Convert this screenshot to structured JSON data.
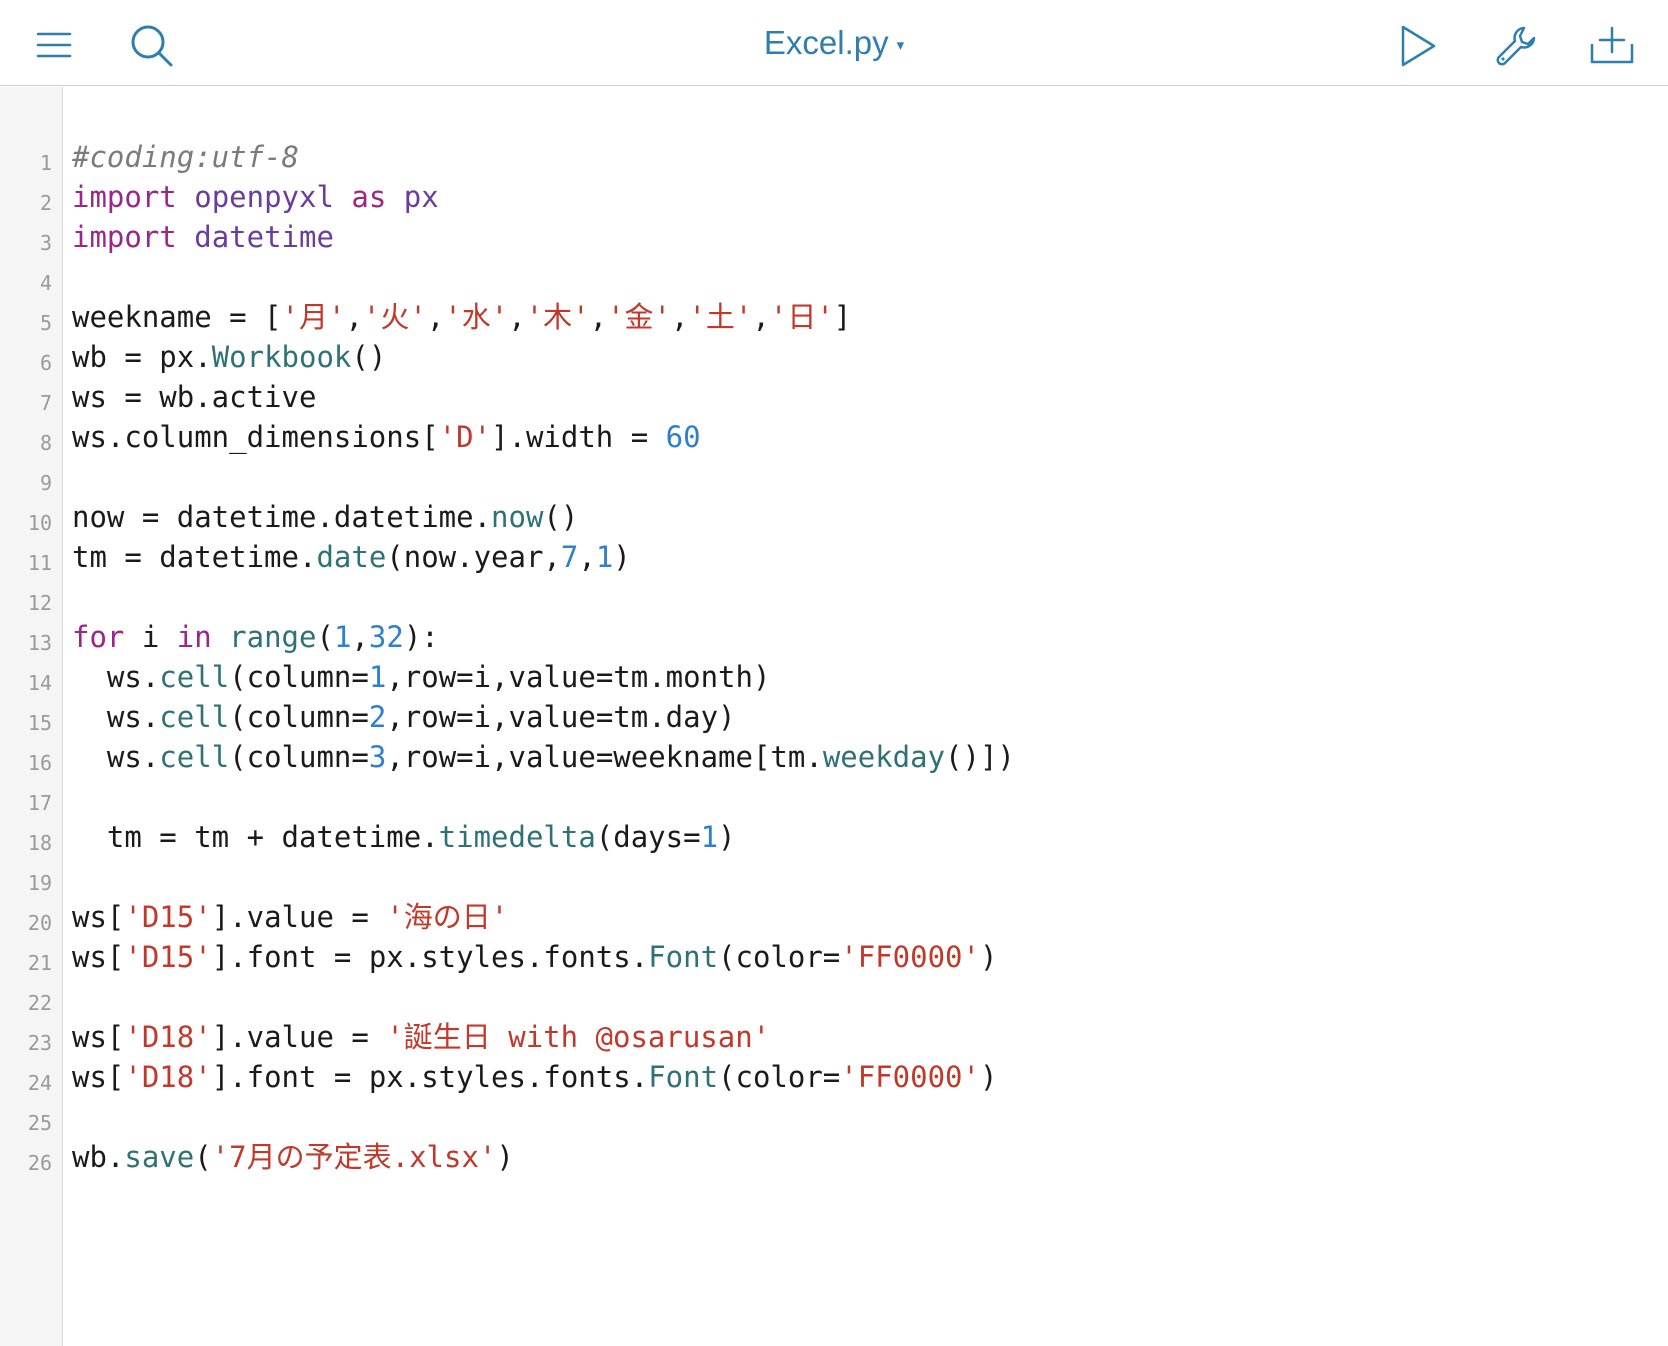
{
  "toolbar": {
    "file_name": "Excel.py",
    "dropdown_caret": "▾",
    "icons": {
      "menu": "hamburger-menu-icon",
      "search": "magnifier-search-icon",
      "run": "play-triangle-icon",
      "settings": "wrench-icon",
      "new": "tray-plus-icon"
    },
    "accent_color": "#2f7fae"
  },
  "editor": {
    "syntax_colors": {
      "comment": "#7b7b7b",
      "keyword": "#9a2788",
      "module": "#6a3c9c",
      "string": "#c0392b",
      "number": "#2f7fcf",
      "function": "#2e7277",
      "text": "#1a1a1a"
    },
    "lines": [
      {
        "n": "1",
        "tokens": [
          {
            "t": "#coding:utf-8",
            "c": "comment"
          }
        ]
      },
      {
        "n": "2",
        "tokens": [
          {
            "t": "import",
            "c": "kw"
          },
          {
            "t": " ",
            "c": "txt"
          },
          {
            "t": "openpyxl",
            "c": "mod"
          },
          {
            "t": " ",
            "c": "txt"
          },
          {
            "t": "as",
            "c": "kw"
          },
          {
            "t": " ",
            "c": "txt"
          },
          {
            "t": "px",
            "c": "mod"
          }
        ]
      },
      {
        "n": "3",
        "tokens": [
          {
            "t": "import",
            "c": "kw"
          },
          {
            "t": " ",
            "c": "txt"
          },
          {
            "t": "datetime",
            "c": "mod"
          }
        ]
      },
      {
        "n": "4",
        "tokens": []
      },
      {
        "n": "5",
        "tokens": [
          {
            "t": "weekname = [",
            "c": "txt"
          },
          {
            "t": "'月'",
            "c": "str"
          },
          {
            "t": ",",
            "c": "txt"
          },
          {
            "t": "'火'",
            "c": "str"
          },
          {
            "t": ",",
            "c": "txt"
          },
          {
            "t": "'水'",
            "c": "str"
          },
          {
            "t": ",",
            "c": "txt"
          },
          {
            "t": "'木'",
            "c": "str"
          },
          {
            "t": ",",
            "c": "txt"
          },
          {
            "t": "'金'",
            "c": "str"
          },
          {
            "t": ",",
            "c": "txt"
          },
          {
            "t": "'土'",
            "c": "str"
          },
          {
            "t": ",",
            "c": "txt"
          },
          {
            "t": "'日'",
            "c": "str"
          },
          {
            "t": "]",
            "c": "txt"
          }
        ]
      },
      {
        "n": "6",
        "tokens": [
          {
            "t": "wb = px.",
            "c": "txt"
          },
          {
            "t": "Workbook",
            "c": "fn"
          },
          {
            "t": "()",
            "c": "txt"
          }
        ]
      },
      {
        "n": "7",
        "tokens": [
          {
            "t": "ws = wb.active",
            "c": "txt"
          }
        ]
      },
      {
        "n": "8",
        "tokens": [
          {
            "t": "ws.column_dimensions[",
            "c": "txt"
          },
          {
            "t": "'D'",
            "c": "str"
          },
          {
            "t": "].width = ",
            "c": "txt"
          },
          {
            "t": "60",
            "c": "num"
          }
        ]
      },
      {
        "n": "9",
        "tokens": []
      },
      {
        "n": "10",
        "tokens": [
          {
            "t": "now = datetime.datetime.",
            "c": "txt"
          },
          {
            "t": "now",
            "c": "fn"
          },
          {
            "t": "()",
            "c": "txt"
          }
        ]
      },
      {
        "n": "11",
        "tokens": [
          {
            "t": "tm = datetime.",
            "c": "txt"
          },
          {
            "t": "date",
            "c": "fn"
          },
          {
            "t": "(now.year,",
            "c": "txt"
          },
          {
            "t": "7",
            "c": "num"
          },
          {
            "t": ",",
            "c": "txt"
          },
          {
            "t": "1",
            "c": "num"
          },
          {
            "t": ")",
            "c": "txt"
          }
        ]
      },
      {
        "n": "12",
        "tokens": []
      },
      {
        "n": "13",
        "tokens": [
          {
            "t": "for",
            "c": "kw"
          },
          {
            "t": " i ",
            "c": "txt"
          },
          {
            "t": "in",
            "c": "kw"
          },
          {
            "t": " ",
            "c": "txt"
          },
          {
            "t": "range",
            "c": "fn"
          },
          {
            "t": "(",
            "c": "txt"
          },
          {
            "t": "1",
            "c": "num"
          },
          {
            "t": ",",
            "c": "txt"
          },
          {
            "t": "32",
            "c": "num"
          },
          {
            "t": "):",
            "c": "txt"
          }
        ]
      },
      {
        "n": "14",
        "tokens": [
          {
            "t": "  ws.",
            "c": "txt"
          },
          {
            "t": "cell",
            "c": "fn"
          },
          {
            "t": "(column=",
            "c": "txt"
          },
          {
            "t": "1",
            "c": "num"
          },
          {
            "t": ",row=i,value=tm.month)",
            "c": "txt"
          }
        ]
      },
      {
        "n": "15",
        "tokens": [
          {
            "t": "  ws.",
            "c": "txt"
          },
          {
            "t": "cell",
            "c": "fn"
          },
          {
            "t": "(column=",
            "c": "txt"
          },
          {
            "t": "2",
            "c": "num"
          },
          {
            "t": ",row=i,value=tm.day)",
            "c": "txt"
          }
        ]
      },
      {
        "n": "16",
        "tokens": [
          {
            "t": "  ws.",
            "c": "txt"
          },
          {
            "t": "cell",
            "c": "fn"
          },
          {
            "t": "(column=",
            "c": "txt"
          },
          {
            "t": "3",
            "c": "num"
          },
          {
            "t": ",row=i,value=weekname[tm.",
            "c": "txt"
          },
          {
            "t": "weekday",
            "c": "fn"
          },
          {
            "t": "()])",
            "c": "txt"
          }
        ]
      },
      {
        "n": "17",
        "tokens": []
      },
      {
        "n": "18",
        "tokens": [
          {
            "t": "  tm = tm + datetime.",
            "c": "txt"
          },
          {
            "t": "timedelta",
            "c": "fn"
          },
          {
            "t": "(days=",
            "c": "txt"
          },
          {
            "t": "1",
            "c": "num"
          },
          {
            "t": ")",
            "c": "txt"
          }
        ]
      },
      {
        "n": "19",
        "tokens": []
      },
      {
        "n": "20",
        "tokens": [
          {
            "t": "ws[",
            "c": "txt"
          },
          {
            "t": "'D15'",
            "c": "str"
          },
          {
            "t": "].value = ",
            "c": "txt"
          },
          {
            "t": "'海の日'",
            "c": "str"
          }
        ]
      },
      {
        "n": "21",
        "tokens": [
          {
            "t": "ws[",
            "c": "txt"
          },
          {
            "t": "'D15'",
            "c": "str"
          },
          {
            "t": "].font = px.styles.fonts.",
            "c": "txt"
          },
          {
            "t": "Font",
            "c": "fn"
          },
          {
            "t": "(color=",
            "c": "txt"
          },
          {
            "t": "'FF0000'",
            "c": "str"
          },
          {
            "t": ")",
            "c": "txt"
          }
        ]
      },
      {
        "n": "22",
        "tokens": []
      },
      {
        "n": "23",
        "tokens": [
          {
            "t": "ws[",
            "c": "txt"
          },
          {
            "t": "'D18'",
            "c": "str"
          },
          {
            "t": "].value = ",
            "c": "txt"
          },
          {
            "t": "'誕生日 with @osarusan'",
            "c": "str"
          }
        ]
      },
      {
        "n": "24",
        "tokens": [
          {
            "t": "ws[",
            "c": "txt"
          },
          {
            "t": "'D18'",
            "c": "str"
          },
          {
            "t": "].font = px.styles.fonts.",
            "c": "txt"
          },
          {
            "t": "Font",
            "c": "fn"
          },
          {
            "t": "(color=",
            "c": "txt"
          },
          {
            "t": "'FF0000'",
            "c": "str"
          },
          {
            "t": ")",
            "c": "txt"
          }
        ]
      },
      {
        "n": "25",
        "tokens": []
      },
      {
        "n": "26",
        "tokens": [
          {
            "t": "wb.",
            "c": "txt"
          },
          {
            "t": "save",
            "c": "fn"
          },
          {
            "t": "(",
            "c": "txt"
          },
          {
            "t": "'7月の予定表.xlsx'",
            "c": "str"
          },
          {
            "t": ")",
            "c": "txt"
          }
        ]
      }
    ]
  }
}
